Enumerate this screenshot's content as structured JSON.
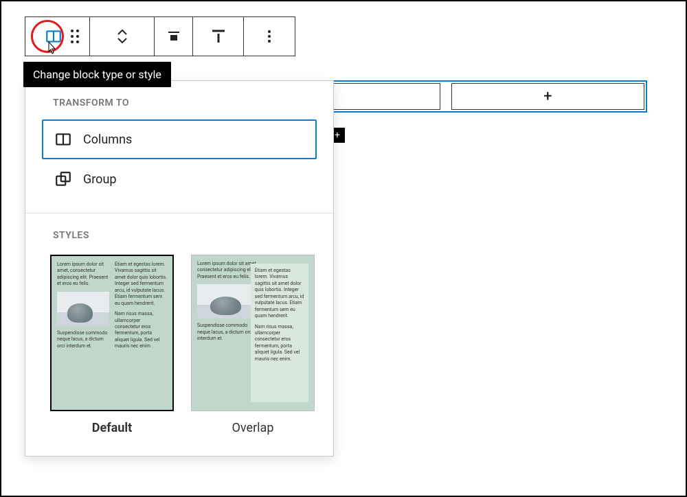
{
  "tooltip": "Change block type or style",
  "toolbar": {
    "block_type_btn": "change-block-type",
    "drag_btn": "drag-handle",
    "move_btn": "move-up-down",
    "align_btn": "align",
    "vertical_align_btn": "vertical-align",
    "options_btn": "options"
  },
  "popover": {
    "transform_label": "TRANSFORM TO",
    "transforms": [
      {
        "label": "Columns",
        "selected": true,
        "icon": "columns-icon"
      },
      {
        "label": "Group",
        "selected": false,
        "icon": "group-icon"
      }
    ],
    "styles_label": "STYLES",
    "styles": [
      {
        "label": "Default",
        "selected": true
      },
      {
        "label": "Overlap",
        "selected": false
      }
    ]
  },
  "lipsum": {
    "a": "Lorem ipsum dolor sit amet, consectetur adipiscing elit. Praesent et eros eu felis.",
    "b": "Etiam et egestas lorem. Vivamus sagittis sit amet dolor quis lobortis. Integer sed fermentum arcu, id vulputate lacus. Etiam fermentum sem eu quam hendrerit.",
    "c": "Suspendisse commodo neque lacus, a dictum orci interdum et.",
    "d": "Nam risus massa, ullamcorper consectetur eros fermentum, porta aliquet ligula. Sed vel mauris nec enim.",
    "b2": "Lorem ipsum dolor sit amet, consectetur adipiscing elit. Praesent et eros eu felis."
  },
  "icons": {
    "plus": "+"
  }
}
